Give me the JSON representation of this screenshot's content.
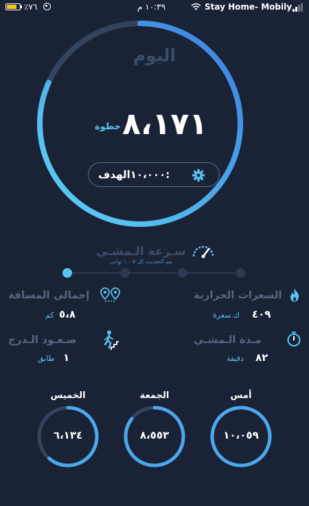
{
  "status_bar": {
    "battery_percent": "٪٧٦",
    "battery_level": 0.76,
    "time": "١٠:٣٩ م",
    "carrier": "Stay Home- Mobily"
  },
  "today": {
    "title": "اليوم",
    "steps": "٨،١٧١",
    "steps_unit": "خطوة",
    "progress": 0.8171,
    "goal_label": "الهدف:",
    "goal_value": "١٠،٠٠٠"
  },
  "speed": {
    "title": "سـرعة الـمشـي",
    "subtitle": "يتم التحديث كل ١٠٠٥ ثواني",
    "selected_index": 0,
    "steps_count": 4
  },
  "stats": {
    "calories_title": "السعرات الحرارية",
    "calories_value": "٤٠٩",
    "calories_unit": "ك.سعرة",
    "distance_title": "إجمالي المسافة",
    "distance_value": "٥،٨",
    "distance_unit": "كم",
    "walk_time_title": "مـدة الـمشـي",
    "walk_time_value": "٨٢",
    "walk_time_unit": "دقيقة",
    "stairs_title": "صـعـود الـدرج",
    "stairs_value": "١",
    "stairs_unit": "طابق"
  },
  "history": [
    {
      "label": "أمس",
      "value": "١٠،٠٥٩",
      "progress": 1.0
    },
    {
      "label": "الجمعة",
      "value": "٨،٥٥٣",
      "progress": 0.855
    },
    {
      "label": "الخميس",
      "value": "٦،١٣٤",
      "progress": 0.613
    }
  ],
  "colors": {
    "background": "#1a2236",
    "accent": "#57c4f0",
    "ring_track": "#34445f",
    "muted_text": "#566682"
  }
}
